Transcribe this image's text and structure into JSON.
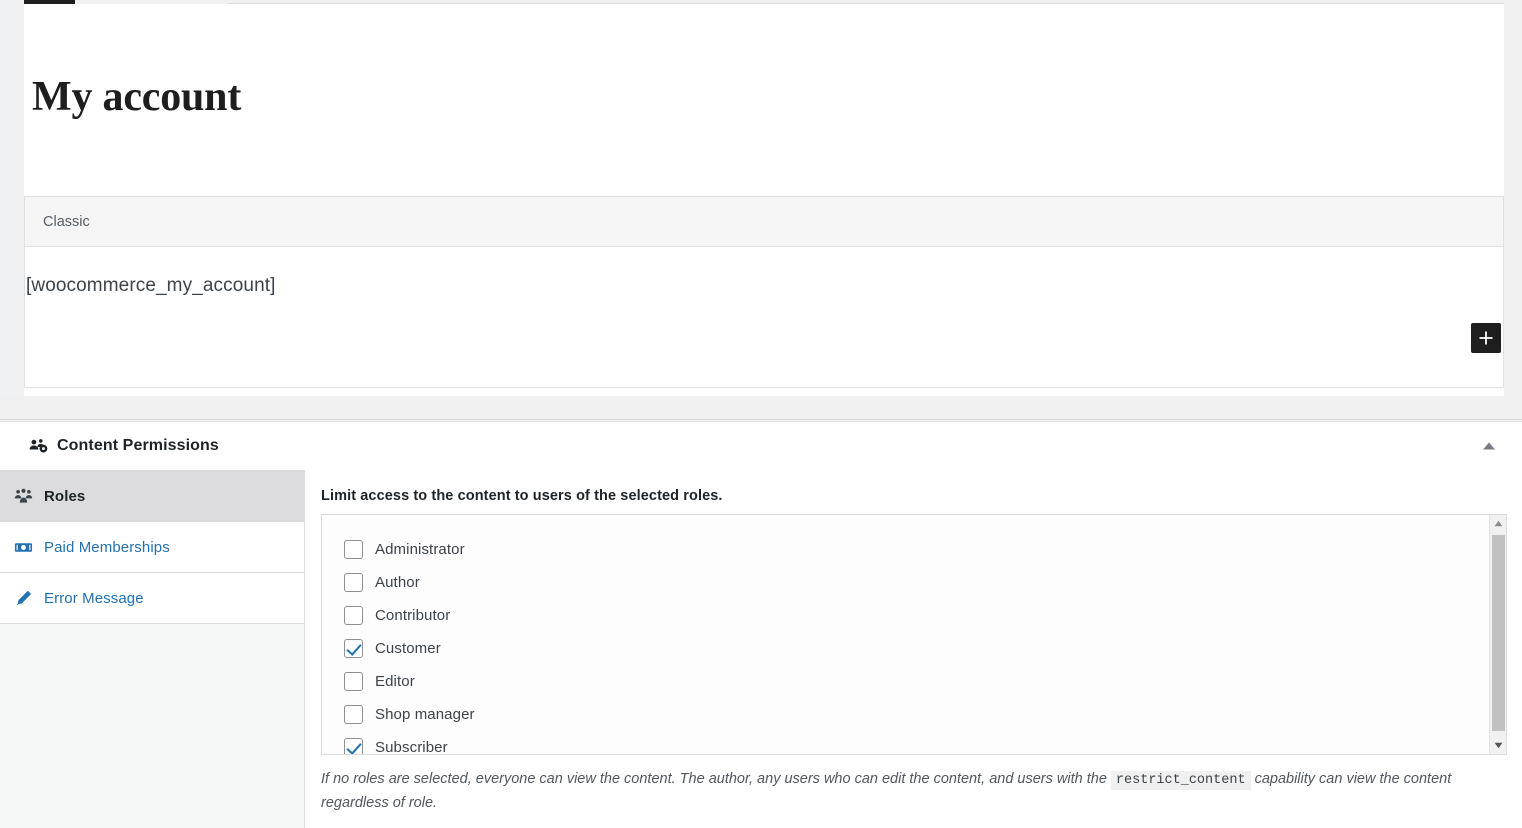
{
  "editor": {
    "post_title": "My account",
    "block": {
      "name": "Classic",
      "content": "[woocommerce_my_account]"
    },
    "add_block_button_label": "+",
    "add_block_icon": "plus-icon"
  },
  "metabox": {
    "title": "Content Permissions",
    "icon": "buddicons-groups-icon",
    "toggle_icon": "triangle-up-icon",
    "tabs": [
      {
        "label": "Roles",
        "icon": "groups-icon",
        "active": true
      },
      {
        "label": "Paid Memberships",
        "icon": "money-icon",
        "active": false
      },
      {
        "label": "Error Message",
        "icon": "pencil-icon",
        "active": false
      }
    ],
    "panel": {
      "heading": "Limit access to the content to users of the selected roles.",
      "roles": [
        {
          "label": "Administrator",
          "checked": false
        },
        {
          "label": "Author",
          "checked": false
        },
        {
          "label": "Contributor",
          "checked": false
        },
        {
          "label": "Customer",
          "checked": true
        },
        {
          "label": "Editor",
          "checked": false
        },
        {
          "label": "Shop manager",
          "checked": false
        },
        {
          "label": "Subscriber",
          "checked": true
        }
      ],
      "help_text_before": "If no roles are selected, everyone can view the content. The author, any users who can edit the content, and users with the ",
      "help_code": "restrict_content",
      "help_text_after": " capability can view the content regardless of role.",
      "scrollbar": {
        "up_icon": "scroll-up-icon",
        "down_icon": "scroll-down-icon"
      }
    }
  },
  "colors": {
    "accent": "#2271b1",
    "dark": "#1e1e1e",
    "panel_bg": "#f0f0f1",
    "active_tab_bg": "#dcdcde"
  }
}
